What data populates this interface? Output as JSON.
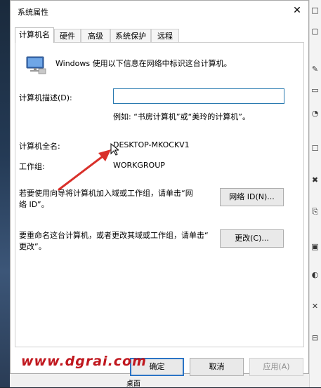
{
  "window": {
    "title": "系统属性",
    "close_glyph": "✕"
  },
  "tabs": [
    {
      "label": "计算机名",
      "active": true
    },
    {
      "label": "硬件",
      "active": false
    },
    {
      "label": "高级",
      "active": false
    },
    {
      "label": "系统保护",
      "active": false
    },
    {
      "label": "远程",
      "active": false
    }
  ],
  "content": {
    "intro": "Windows 使用以下信息在网络中标识这台计算机。",
    "desc_label": "计算机描述(D):",
    "desc_value": "",
    "desc_example": "例如: “书房计算机”或“美玲的计算机”。",
    "fullname_label": "计算机全名:",
    "fullname_value": "DESKTOP-MKOCKV1",
    "workgroup_label": "工作组:",
    "workgroup_value": "WORKGROUP",
    "network_text_line1": "若要使用向导将计算机加入域或工作组，请单击“网",
    "network_text_line2": "络 ID”。",
    "network_btn": "网络 ID(N)...",
    "rename_text_line1": "要重命名这台计算机，或者更改其域或工作组，请单击“",
    "rename_text_line2": "更改”。",
    "rename_btn": "更改(C)..."
  },
  "footer": {
    "ok": "确定",
    "cancel": "取消",
    "apply": "应用(A)"
  },
  "watermark": "www.dgrai.com",
  "taskbar_text": "桌面",
  "colors": {
    "accent": "#2b74c5",
    "annotation_arrow": "#d9302a",
    "watermark": "#c0171e"
  }
}
